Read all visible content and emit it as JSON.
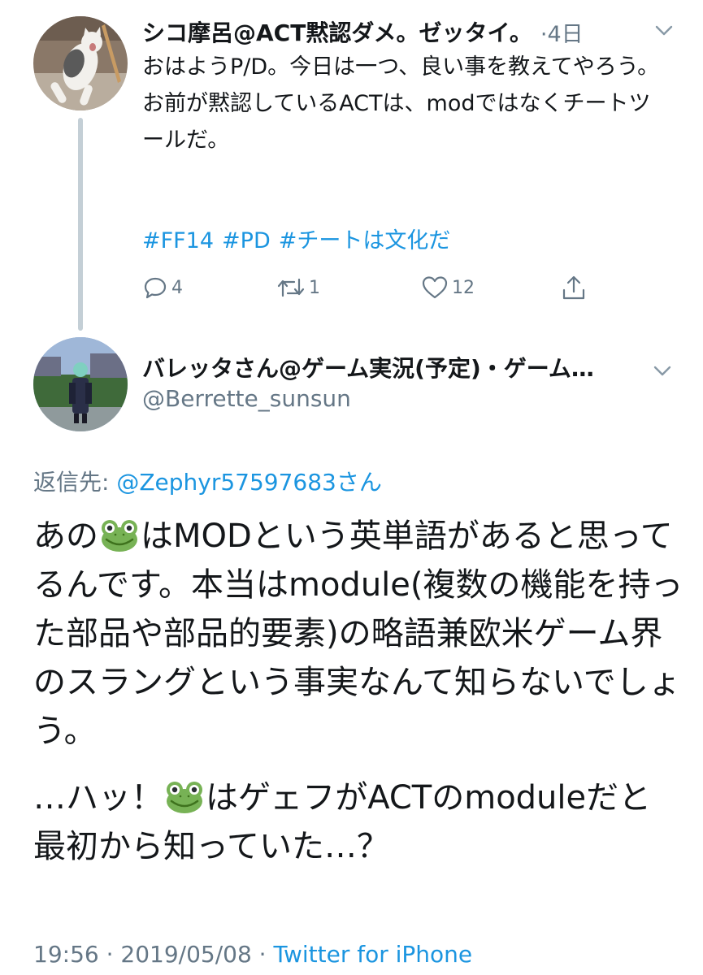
{
  "parent_tweet": {
    "display_name": "シコ摩呂@ACT黙認ダメ。ゼッタイ。",
    "time": "·4日",
    "body": "おはようP/D。今日は一つ、良い事を教えてやろう。\nお前が黙認しているACTは、modではなくチートツールだ。",
    "hashtags": [
      "#FF14",
      "#PD",
      "#チートは文化だ"
    ],
    "actions": {
      "reply_count": "4",
      "retweet_count": "1",
      "like_count": "12"
    },
    "icons": {
      "reply": "reply-icon",
      "retweet": "retweet-icon",
      "like": "heart-icon",
      "share": "share-icon",
      "menu": "chevron-down-icon"
    }
  },
  "main_tweet": {
    "display_name": "バレッタさん@ゲーム実況(予定)・ゲーム…",
    "handle": "@Berrette_sunsun",
    "reply_label": "返信先:",
    "reply_mention": "@Zephyr57597683さん",
    "body_p1_a": "あの",
    "body_p1_b": "はMODという英単語があると思ってるんです。本当はmodule(複数の機能を持った部品や部品的要素)の略語兼欧米ゲーム界のスラングという事実なんて知らないでしょう。",
    "body_p2_a": "…ハッ！",
    "body_p2_b": "はゲェフがACTのmoduleだと最初から知っていた…？",
    "timestamp": "19:56 · 2019/05/08 · ",
    "client": "Twitter for iPhone"
  },
  "colors": {
    "link": "#1b95e0",
    "secondary_text": "#657786",
    "primary_text": "#14171a",
    "thread_line": "#c4cfd6"
  }
}
